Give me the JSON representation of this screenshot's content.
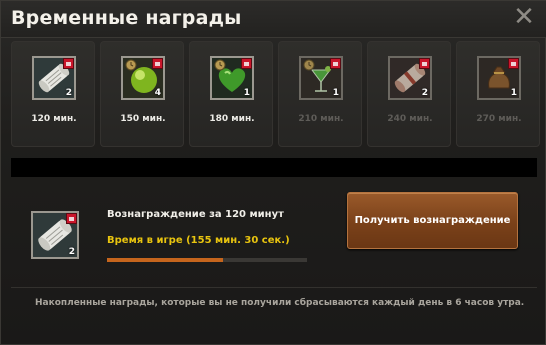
{
  "window": {
    "title": "Временные награды",
    "close_glyph": "✕"
  },
  "rewards": [
    {
      "icon": "scroll-icon",
      "count": "2",
      "time": "120 мин.",
      "locked": false
    },
    {
      "icon": "green-orb-icon",
      "count": "4",
      "time": "150 мин.",
      "locked": false
    },
    {
      "icon": "green-heart-icon",
      "count": "1",
      "time": "180 мин.",
      "locked": false
    },
    {
      "icon": "cocktail-icon",
      "count": "1",
      "time": "210 мин.",
      "locked": true
    },
    {
      "icon": "scroll-red-icon",
      "count": "2",
      "time": "240 мин.",
      "locked": true
    },
    {
      "icon": "pouch-icon",
      "count": "1",
      "time": "270 мин.",
      "locked": true
    }
  ],
  "detail": {
    "icon": "scroll-icon",
    "count": "2",
    "name": "Вознаграждение за 120 минут",
    "time_played": "Время в игре (155 мин. 30 сек.)",
    "progress_fraction": 0.58
  },
  "claim_button": {
    "label": "Получить вознаграждение"
  },
  "footer_note": "Накопленные награды, которые вы не получили сбрасываются каждый день в 6 часов утра.",
  "colors": {
    "accent_time": "#e8c40f",
    "progress": "#c5651d",
    "button": "#7a4119",
    "lock": "#c9162b"
  }
}
